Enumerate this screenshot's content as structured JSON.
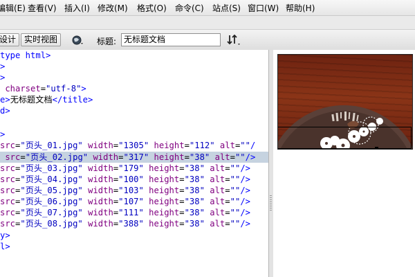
{
  "menu": [
    "编辑(E)",
    "查看(V)",
    "插入(I)",
    "修改(M)",
    "格式(O)",
    "命令(C)",
    "站点(S)",
    "窗口(W)",
    "帮助(H)"
  ],
  "toolbar": {
    "design_label": "设计",
    "live_view_label": "实时视图",
    "title_label": "标题:",
    "title_value": "无标题文档",
    "globe_icon": "globe-icon",
    "sort_icon": "sort-arrows-icon"
  },
  "code": {
    "lines": [
      [
        [
          "t",
          "type html>"
        ]
      ],
      [
        [
          "t",
          ">"
        ]
      ],
      [
        [
          "t",
          ">"
        ]
      ],
      [
        [
          "a",
          " charset"
        ],
        [
          "x",
          "="
        ],
        [
          "v",
          "\"utf-8\""
        ],
        [
          "t",
          ">"
        ]
      ],
      [
        [
          "t",
          "e>"
        ],
        [
          "x",
          "无标题文档"
        ],
        [
          "t",
          "</title>"
        ]
      ],
      [
        [
          "t",
          "d>"
        ]
      ],
      [],
      [
        [
          "t",
          ">"
        ]
      ],
      [
        [
          "a",
          "src"
        ],
        [
          "x",
          "="
        ],
        [
          "v",
          "\"页头_01.jpg\""
        ],
        [
          "a",
          " width"
        ],
        [
          "x",
          "="
        ],
        [
          "v",
          "\"1305\""
        ],
        [
          "a",
          " height"
        ],
        [
          "x",
          "="
        ],
        [
          "v",
          "\"112\""
        ],
        [
          "a",
          " alt"
        ],
        [
          "x",
          "="
        ],
        [
          "v",
          "\"\""
        ],
        [
          "t",
          "/"
        ]
      ],
      [
        [
          "a",
          " src"
        ],
        [
          "x",
          "="
        ],
        [
          "v",
          "\"页头_02.jpg\""
        ],
        [
          "a",
          " width"
        ],
        [
          "x",
          "="
        ],
        [
          "v",
          "\"317\""
        ],
        [
          "a",
          " height"
        ],
        [
          "x",
          "="
        ],
        [
          "v",
          "\"38\""
        ],
        [
          "a",
          " alt"
        ],
        [
          "x",
          "="
        ],
        [
          "v",
          "\"\""
        ],
        [
          "t",
          "/>"
        ]
      ],
      [
        [
          "a",
          "src"
        ],
        [
          "x",
          "="
        ],
        [
          "v",
          "\"页头_03.jpg\""
        ],
        [
          "a",
          " width"
        ],
        [
          "x",
          "="
        ],
        [
          "v",
          "\"179\""
        ],
        [
          "a",
          " height"
        ],
        [
          "x",
          "="
        ],
        [
          "v",
          "\"38\""
        ],
        [
          "a",
          " alt"
        ],
        [
          "x",
          "="
        ],
        [
          "v",
          "\"\""
        ],
        [
          "t",
          "/>"
        ]
      ],
      [
        [
          "a",
          "src"
        ],
        [
          "x",
          "="
        ],
        [
          "v",
          "\"页头_04.jpg\""
        ],
        [
          "a",
          " width"
        ],
        [
          "x",
          "="
        ],
        [
          "v",
          "\"100\""
        ],
        [
          "a",
          " height"
        ],
        [
          "x",
          "="
        ],
        [
          "v",
          "\"38\""
        ],
        [
          "a",
          " alt"
        ],
        [
          "x",
          "="
        ],
        [
          "v",
          "\"\""
        ],
        [
          "t",
          "/>"
        ]
      ],
      [
        [
          "a",
          "src"
        ],
        [
          "x",
          "="
        ],
        [
          "v",
          "\"页头_05.jpg\""
        ],
        [
          "a",
          " width"
        ],
        [
          "x",
          "="
        ],
        [
          "v",
          "\"103\""
        ],
        [
          "a",
          " height"
        ],
        [
          "x",
          "="
        ],
        [
          "v",
          "\"38\""
        ],
        [
          "a",
          " alt"
        ],
        [
          "x",
          "="
        ],
        [
          "v",
          "\"\""
        ],
        [
          "t",
          "/>"
        ]
      ],
      [
        [
          "a",
          "src"
        ],
        [
          "x",
          "="
        ],
        [
          "v",
          "\"页头_06.jpg\""
        ],
        [
          "a",
          " width"
        ],
        [
          "x",
          "="
        ],
        [
          "v",
          "\"107\""
        ],
        [
          "a",
          " height"
        ],
        [
          "x",
          "="
        ],
        [
          "v",
          "\"38\""
        ],
        [
          "a",
          " alt"
        ],
        [
          "x",
          "="
        ],
        [
          "v",
          "\"\""
        ],
        [
          "t",
          "/>"
        ]
      ],
      [
        [
          "a",
          "src"
        ],
        [
          "x",
          "="
        ],
        [
          "v",
          "\"页头_07.jpg\""
        ],
        [
          "a",
          " width"
        ],
        [
          "x",
          "="
        ],
        [
          "v",
          "\"111\""
        ],
        [
          "a",
          " height"
        ],
        [
          "x",
          "="
        ],
        [
          "v",
          "\"38\""
        ],
        [
          "a",
          " alt"
        ],
        [
          "x",
          "="
        ],
        [
          "v",
          "\"\""
        ],
        [
          "t",
          "/>"
        ]
      ],
      [
        [
          "a",
          "src"
        ],
        [
          "x",
          "="
        ],
        [
          "v",
          "\"页头_08.jpg\""
        ],
        [
          "a",
          " width"
        ],
        [
          "x",
          "="
        ],
        [
          "v",
          "\"388\""
        ],
        [
          "a",
          " height"
        ],
        [
          "x",
          "="
        ],
        [
          "v",
          "\"38\""
        ],
        [
          "a",
          " alt"
        ],
        [
          "x",
          "="
        ],
        [
          "v",
          "\"\""
        ],
        [
          "t",
          "/>"
        ]
      ],
      [
        [
          "t",
          "y>"
        ]
      ],
      [
        [
          "t",
          "l>"
        ]
      ]
    ],
    "highlighted_line": 9
  },
  "colors": {
    "tag": "#0000ff",
    "attribute": "#800080",
    "value": "#0000c0",
    "highlight": "#c6d3e0",
    "banner_wood": "#7a2a14"
  }
}
